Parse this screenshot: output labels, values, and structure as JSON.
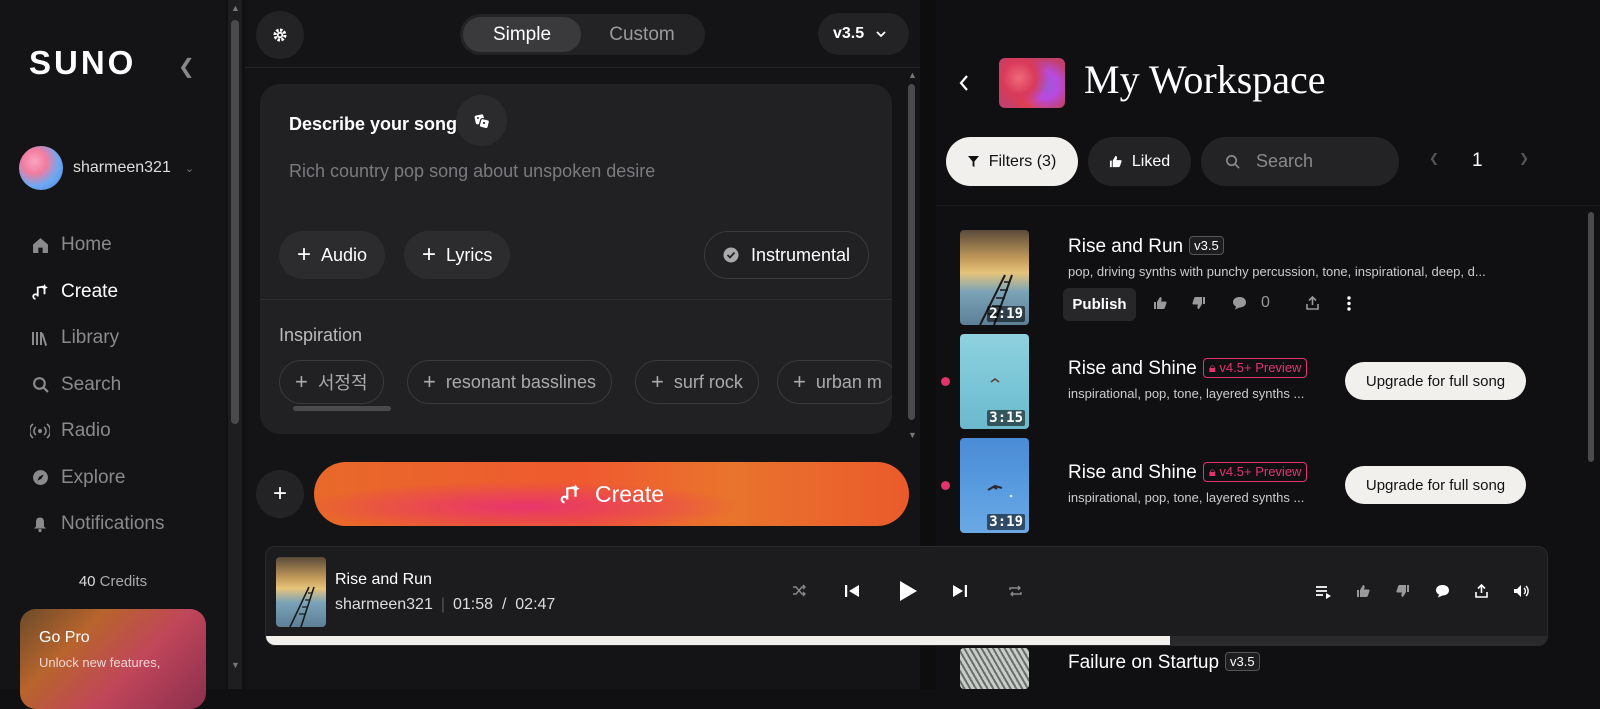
{
  "sidebar": {
    "logo": "SUNO",
    "username": "sharmeen321",
    "nav": [
      {
        "label": "Home",
        "icon": "home-icon",
        "active": false
      },
      {
        "label": "Create",
        "icon": "create-icon",
        "active": true
      },
      {
        "label": "Library",
        "icon": "library-icon",
        "active": false
      },
      {
        "label": "Search",
        "icon": "search-icon",
        "active": false
      },
      {
        "label": "Radio",
        "icon": "radio-icon",
        "active": false
      },
      {
        "label": "Explore",
        "icon": "explore-icon",
        "active": false
      },
      {
        "label": "Notifications",
        "icon": "bell-icon",
        "active": false
      }
    ],
    "credits_count": "40",
    "credits_label": "Credits",
    "gopro_title": "Go Pro",
    "gopro_subtitle": "Unlock new features,"
  },
  "create": {
    "mode_simple": "Simple",
    "mode_custom": "Custom",
    "active_mode": "Simple",
    "version": "v3.5",
    "describe_label": "Describe your song",
    "describe_placeholder": "Rich country pop song about unspoken desire",
    "audio_label": "Audio",
    "lyrics_label": "Lyrics",
    "instrumental_label": "Instrumental",
    "inspiration_label": "Inspiration",
    "inspiration_chips": [
      "서정적",
      "resonant basslines",
      "surf rock",
      "urban m"
    ],
    "create_label": "Create"
  },
  "workspace": {
    "title": "My Workspace",
    "filters_label": "Filters (3)",
    "liked_label": "Liked",
    "search_placeholder": "Search",
    "page": "1",
    "songs": [
      {
        "title": "Rise and Run",
        "badge": "v3.5",
        "tags": "pop, driving synths with punchy percussion, tone, inspirational, deep, d...",
        "duration": "2:19",
        "publish_label": "Publish",
        "comments": "0"
      },
      {
        "title": "Rise and Shine",
        "badge": "v4.5+ Preview",
        "tags": "inspirational, pop, tone, layered synths ...",
        "duration": "3:15",
        "upgrade_label": "Upgrade for full song"
      },
      {
        "title": "Rise and Shine",
        "badge": "v4.5+ Preview",
        "tags": "inspirational, pop, tone, layered synths ...",
        "duration": "3:19",
        "upgrade_label": "Upgrade for full song"
      },
      {
        "title": "Failure on Startup",
        "badge": "v3.5"
      }
    ]
  },
  "player": {
    "title": "Rise and Run",
    "artist": "sharmeen321",
    "current_time": "01:58",
    "separator": "/",
    "total_time": "02:47",
    "progress": 0.706
  },
  "colors": {
    "accent_pink": "#e0356b",
    "create_orange": "#ea5a2c",
    "light_pill": "#f2f0ec"
  }
}
